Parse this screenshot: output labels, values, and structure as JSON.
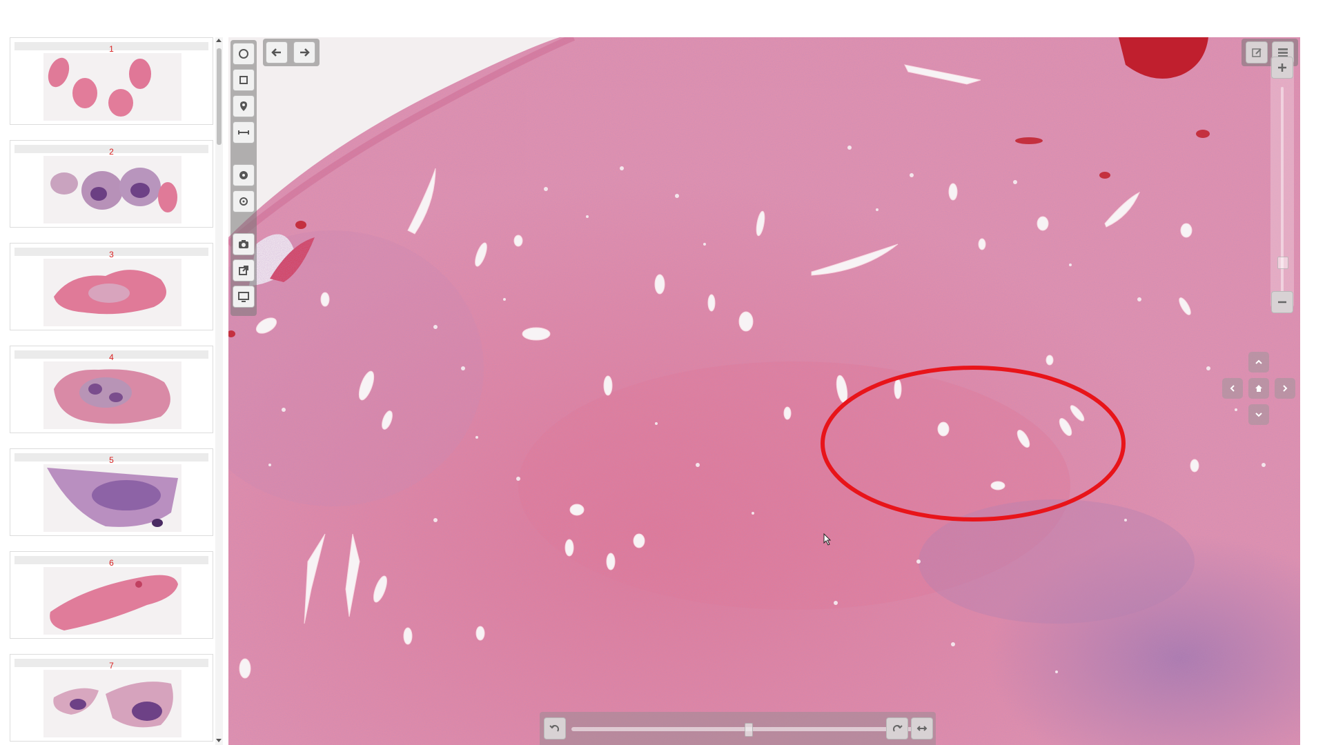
{
  "thumbnails": [
    {
      "number": "1"
    },
    {
      "number": "2"
    },
    {
      "number": "3"
    },
    {
      "number": "4"
    },
    {
      "number": "5"
    },
    {
      "number": "6"
    },
    {
      "number": "7"
    }
  ],
  "toolbar": {
    "left_tools": [
      "circle-tool-icon",
      "rectangle-tool-icon",
      "marker-pin-icon",
      "ruler-line-icon",
      "settings-gear-icon",
      "adjust-gear-icon",
      "camera-icon",
      "external-link-icon",
      "monitor-icon"
    ],
    "nav": [
      "arrow-left-icon",
      "arrow-right-icon"
    ],
    "top_right": [
      "edit-annotation-icon",
      "layers-list-icon"
    ]
  },
  "zoom": {
    "plus": "zoom-in-icon",
    "minus": "zoom-out-icon"
  },
  "rotation": {
    "left": "rotate-left-icon",
    "right": "rotate-right-icon",
    "flip": "flip-horizontal-icon"
  },
  "annotation": {
    "shape": "ellipse",
    "color": "#e8141a"
  },
  "colors": {
    "tissue_pink": "#e58aa6",
    "stroma_purple": "#9a6fa5",
    "annotation_red": "#e8141a",
    "thumb_number_red": "#d81e1e"
  }
}
